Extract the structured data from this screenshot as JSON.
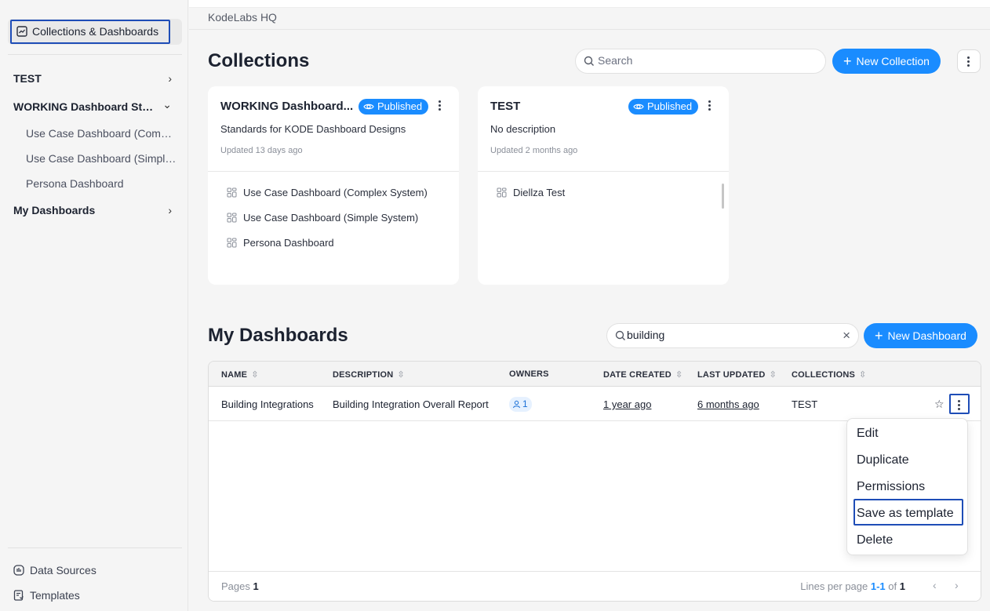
{
  "sidebar": {
    "top_item": "Collections & Dashboards",
    "items": [
      {
        "label": "TEST",
        "chevron": "›"
      },
      {
        "label": "WORKING Dashboard Standards",
        "chevron": "⌄"
      },
      {
        "label": "Use Case Dashboard (Complex System)"
      },
      {
        "label": "Use Case Dashboard (Simple System)"
      },
      {
        "label": "Persona Dashboard"
      },
      {
        "label": "My Dashboards",
        "chevron": "›"
      }
    ],
    "bottom": [
      {
        "label": "Data Sources",
        "icon": "data-sources-icon"
      },
      {
        "label": "Templates",
        "icon": "templates-icon"
      }
    ]
  },
  "breadcrumb": "KodeLabs HQ",
  "collections": {
    "title": "Collections",
    "search_placeholder": "Search",
    "new_button": "New Collection",
    "cards": [
      {
        "title": "WORKING Dashboard...",
        "badge": "Published",
        "description": "Standards for KODE Dashboard Designs",
        "updated": "Updated 13 days ago",
        "items": [
          "Use Case Dashboard (Complex System)",
          "Use Case Dashboard (Simple System)",
          "Persona Dashboard"
        ]
      },
      {
        "title": "TEST",
        "badge": "Published",
        "description": "No description",
        "updated": "Updated 2 months ago",
        "items": [
          "Diellza Test"
        ]
      }
    ]
  },
  "dashboards": {
    "title": "My Dashboards",
    "search_value": "building",
    "new_button": "New Dashboard",
    "columns": [
      "NAME",
      "DESCRIPTION",
      "OWNERS",
      "DATE CREATED",
      "LAST UPDATED",
      "COLLECTIONS"
    ],
    "rows": [
      {
        "name": "Building Integrations",
        "description": "Building Integration Overall Report",
        "owners": "1",
        "date_created": "1 year ago",
        "last_updated": "6 months ago",
        "collections": "TEST"
      }
    ],
    "footer": {
      "pages_label": "Pages",
      "pages_value": "1",
      "lines_label": "Lines per page",
      "range": "1-1",
      "of_label": "of",
      "total": "1"
    }
  },
  "context_menu": [
    "Edit",
    "Duplicate",
    "Permissions",
    "Save as template",
    "Delete"
  ],
  "colors": {
    "accent": "#1a8cff",
    "focus_outline": "#1e4db7"
  }
}
